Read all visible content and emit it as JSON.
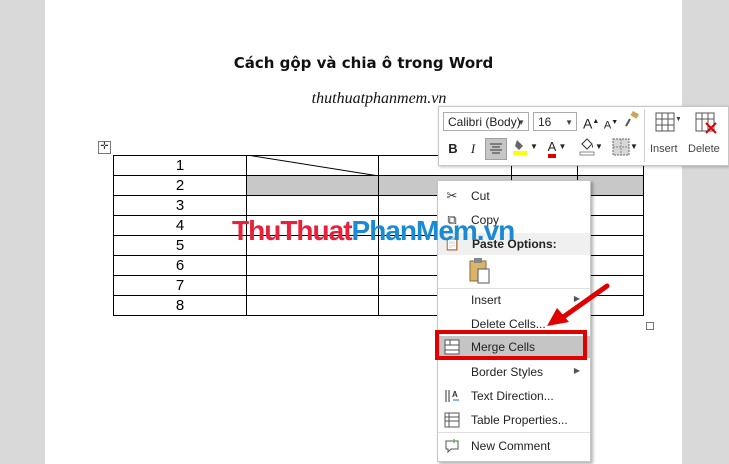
{
  "document": {
    "title": "Cách gộp và chia ô trong Word",
    "subtitle": "thuthuatphanmem.vn",
    "table": {
      "rows": [
        "1",
        "2",
        "3",
        "4",
        "5",
        "6",
        "7",
        "8"
      ]
    },
    "move_handle_glyph": "✛"
  },
  "mini_toolbar": {
    "font_name": "Calibri (Body)",
    "font_size": "16",
    "grow_font": "A",
    "shrink_font": "A",
    "bold": "B",
    "italic": "I",
    "font_color_letter": "A",
    "insert_label": "Insert",
    "delete_label": "Delete",
    "highlight_color": "#ffff00",
    "font_color": "#e00000"
  },
  "context_menu": {
    "items": [
      {
        "label": "Cut",
        "icon": "scissors-icon"
      },
      {
        "label": "Copy",
        "icon": "copy-icon"
      },
      {
        "label": "Paste Options:",
        "icon": "paste-icon"
      },
      {
        "label": "Insert",
        "icon": "",
        "submenu": true
      },
      {
        "label": "Delete Cells...",
        "icon": ""
      },
      {
        "label": "Merge Cells",
        "icon": "merge-cells-icon",
        "highlighted": true
      },
      {
        "label": "Border Styles",
        "icon": "",
        "submenu": true
      },
      {
        "label": "Text Direction...",
        "icon": "text-direction-icon"
      },
      {
        "label": "Table Properties...",
        "icon": "table-properties-icon"
      },
      {
        "label": "New Comment",
        "icon": "comment-icon"
      }
    ]
  },
  "watermark": {
    "part1": "Thu",
    "part2": "Thuat",
    "part3": "Phan",
    "part4": "Mem",
    "part5": ".vn",
    "colors": [
      "#e8203a",
      "#1a8ad4"
    ]
  },
  "annotation": {
    "arrow_color": "#e10000",
    "box_color": "#e10000"
  }
}
